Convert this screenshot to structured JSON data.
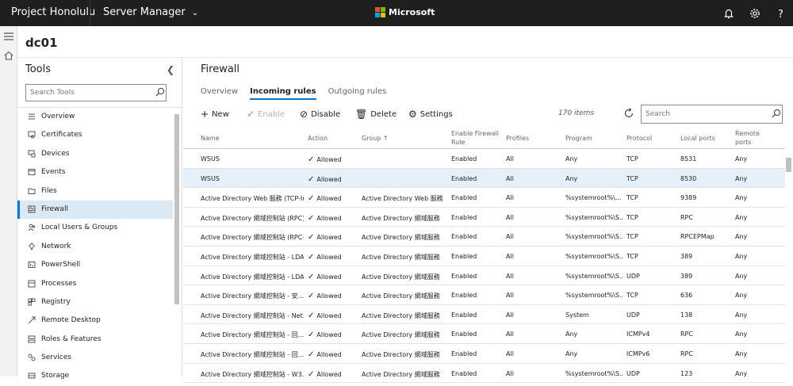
{
  "topbar": {
    "brand": "Project Honolulu",
    "product": "Server Manager",
    "microsoft": "Microsoft",
    "ms_colors": [
      "#f25022",
      "#7fba00",
      "#00a4ef",
      "#ffb900"
    ],
    "icons": [
      "bell-icon",
      "gear-icon",
      "help-icon"
    ]
  },
  "leftstrip": {
    "icons": [
      "hamburger-icon",
      "home-icon"
    ]
  },
  "server": {
    "name": "dc01"
  },
  "tools": {
    "title": "Tools",
    "search_placeholder": "Search Tools",
    "items": [
      {
        "label": "Overview",
        "icon": "list-icon"
      },
      {
        "label": "Certificates",
        "icon": "certificate-icon"
      },
      {
        "label": "Devices",
        "icon": "devices-icon"
      },
      {
        "label": "Events",
        "icon": "events-icon"
      },
      {
        "label": "Files",
        "icon": "folder-icon"
      },
      {
        "label": "Firewall",
        "icon": "firewall-icon",
        "active": true
      },
      {
        "label": "Local Users & Groups",
        "icon": "users-icon"
      },
      {
        "label": "Network",
        "icon": "network-icon"
      },
      {
        "label": "PowerShell",
        "icon": "powershell-icon"
      },
      {
        "label": "Processes",
        "icon": "processes-icon"
      },
      {
        "label": "Registry",
        "icon": "registry-icon"
      },
      {
        "label": "Remote Desktop",
        "icon": "remote-desktop-icon"
      },
      {
        "label": "Roles & Features",
        "icon": "roles-icon"
      },
      {
        "label": "Services",
        "icon": "services-icon"
      },
      {
        "label": "Storage",
        "icon": "storage-icon"
      }
    ]
  },
  "firewall": {
    "title": "Firewall",
    "tabs": [
      {
        "label": "Overview",
        "active": false
      },
      {
        "label": "Incoming rules",
        "active": true
      },
      {
        "label": "Outgoing rules",
        "active": false
      }
    ],
    "toolbar": {
      "new": "New",
      "enable": "Enable",
      "disable": "Disable",
      "delete": "Delete",
      "settings": "Settings",
      "count": "170 items",
      "search_placeholder": "Search"
    },
    "columns": {
      "name": "Name",
      "action": "Action",
      "group": "Group",
      "enable_line1": "Enable Firewall",
      "enable_line2": "Rule",
      "profiles": "Profiles",
      "program": "Program",
      "protocol": "Protocol",
      "local_ports": "Local ports",
      "remote_line1": "Remote",
      "remote_line2": "ports"
    },
    "rows": [
      {
        "name": "WSUS",
        "action": "Allowed",
        "group": "",
        "enabled": "Enabled",
        "profiles": "All",
        "program": "Any",
        "protocol": "TCP",
        "local_ports": "8531",
        "remote_ports": "Any"
      },
      {
        "name": "WSUS",
        "action": "Allowed",
        "group": "",
        "enabled": "Enabled",
        "profiles": "All",
        "program": "Any",
        "protocol": "TCP",
        "local_ports": "8530",
        "remote_ports": "Any",
        "selected": true
      },
      {
        "name": "Active Directory Web 服務 (TCP-In)",
        "action": "Allowed",
        "group": "Active Directory Web 服務",
        "enabled": "Enabled",
        "profiles": "All",
        "program": "%systemroot%\\...",
        "protocol": "TCP",
        "local_ports": "9389",
        "remote_ports": "Any"
      },
      {
        "name": "Active Directory 網域控制站 (RPC)",
        "action": "Allowed",
        "group": "Active Directory 網域服務",
        "enabled": "Enabled",
        "profiles": "All",
        "program": "%systemroot%\\S...",
        "protocol": "TCP",
        "local_ports": "RPC",
        "remote_ports": "Any"
      },
      {
        "name": "Active Directory 網域控制站 (RPC-...",
        "action": "Allowed",
        "group": "Active Directory 網域服務",
        "enabled": "Enabled",
        "profiles": "All",
        "program": "%systemroot%\\S...",
        "protocol": "TCP",
        "local_ports": "RPCEPMap",
        "remote_ports": "Any"
      },
      {
        "name": "Active Directory 網域控制站 - LDA...",
        "action": "Allowed",
        "group": "Active Directory 網域服務",
        "enabled": "Enabled",
        "profiles": "All",
        "program": "%systemroot%\\S...",
        "protocol": "TCP",
        "local_ports": "389",
        "remote_ports": "Any"
      },
      {
        "name": "Active Directory 網域控制站 - LDA...",
        "action": "Allowed",
        "group": "Active Directory 網域服務",
        "enabled": "Enabled",
        "profiles": "All",
        "program": "%systemroot%\\S...",
        "protocol": "UDP",
        "local_ports": "389",
        "remote_ports": "Any"
      },
      {
        "name": "Active Directory 網域控制站 - 安...",
        "action": "Allowed",
        "group": "Active Directory 網域服務",
        "enabled": "Enabled",
        "profiles": "All",
        "program": "%systemroot%\\S...",
        "protocol": "TCP",
        "local_ports": "636",
        "remote_ports": "Any"
      },
      {
        "name": "Active Directory 網域控制站 - Net...",
        "action": "Allowed",
        "group": "Active Directory 網域服務",
        "enabled": "Enabled",
        "profiles": "All",
        "program": "System",
        "protocol": "UDP",
        "local_ports": "138",
        "remote_ports": "Any"
      },
      {
        "name": "Active Directory 網域控制站 - 回...",
        "action": "Allowed",
        "group": "Active Directory 網域服務",
        "enabled": "Enabled",
        "profiles": "All",
        "program": "Any",
        "protocol": "ICMPv4",
        "local_ports": "RPC",
        "remote_ports": "Any"
      },
      {
        "name": "Active Directory 網域控制站 - 回...",
        "action": "Allowed",
        "group": "Active Directory 網域服務",
        "enabled": "Enabled",
        "profiles": "All",
        "program": "Any",
        "protocol": "ICMPv6",
        "local_ports": "RPC",
        "remote_ports": "Any"
      },
      {
        "name": "Active Directory 網域控制站 - W3...",
        "action": "Allowed",
        "group": "Active Directory 網域服務",
        "enabled": "Enabled",
        "profiles": "All",
        "program": "%systemroot%\\S...",
        "protocol": "UDP",
        "local_ports": "123",
        "remote_ports": "Any"
      }
    ]
  }
}
